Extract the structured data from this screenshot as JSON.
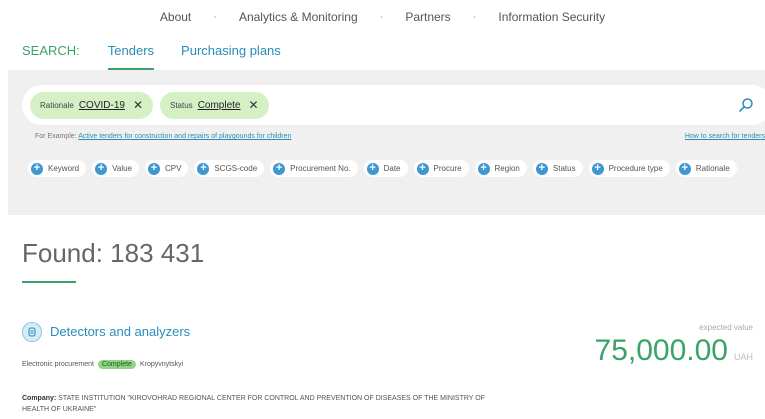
{
  "nav": {
    "items": [
      "About",
      "Analytics & Monitoring",
      "Partners",
      "Information Security"
    ],
    "separator": "·"
  },
  "search": {
    "label": "SEARCH:",
    "tabs": [
      {
        "label": "Tenders",
        "active": true
      },
      {
        "label": "Purchasing plans",
        "active": false
      }
    ],
    "chips": [
      {
        "key": "Rationale",
        "value": "COVID-19"
      },
      {
        "key": "Status",
        "value": "Complete"
      }
    ],
    "close_glyph": "✕",
    "placeholder": "",
    "example_prefix": "For Example: ",
    "example_link": "Active tenders for construction and repairs of playgounds for children",
    "how_to_link": "How to search for tenders",
    "filters": [
      "Keyword",
      "Value",
      "CPV",
      "SCGS-code",
      "Procurement No.",
      "Date",
      "Procure",
      "Region",
      "Status",
      "Procedure type",
      "Rationale"
    ]
  },
  "results": {
    "found_label": "Found: 183 431"
  },
  "tender": {
    "title": "Detectors and analyzers",
    "procurement_type": "Electronic procurement",
    "status": "Complete",
    "city": "Kropyvnytskyi",
    "expected_label": "expected value",
    "amount": "75,000.00",
    "currency": "UAH",
    "company_label": "Company:",
    "company_name": " STATE INSTITUTION \"KIROVOHRAD REGIONAL CENTER FOR CONTROL AND PREVENTION OF DISEASES OF THE MINISTRY OF HEALTH OF UKRAINE\""
  },
  "colors": {
    "accent_green": "#3aa36a",
    "link_blue": "#2a8cba",
    "chip_bg": "#d6f0c6",
    "panel_bg": "#f0f0f0"
  }
}
